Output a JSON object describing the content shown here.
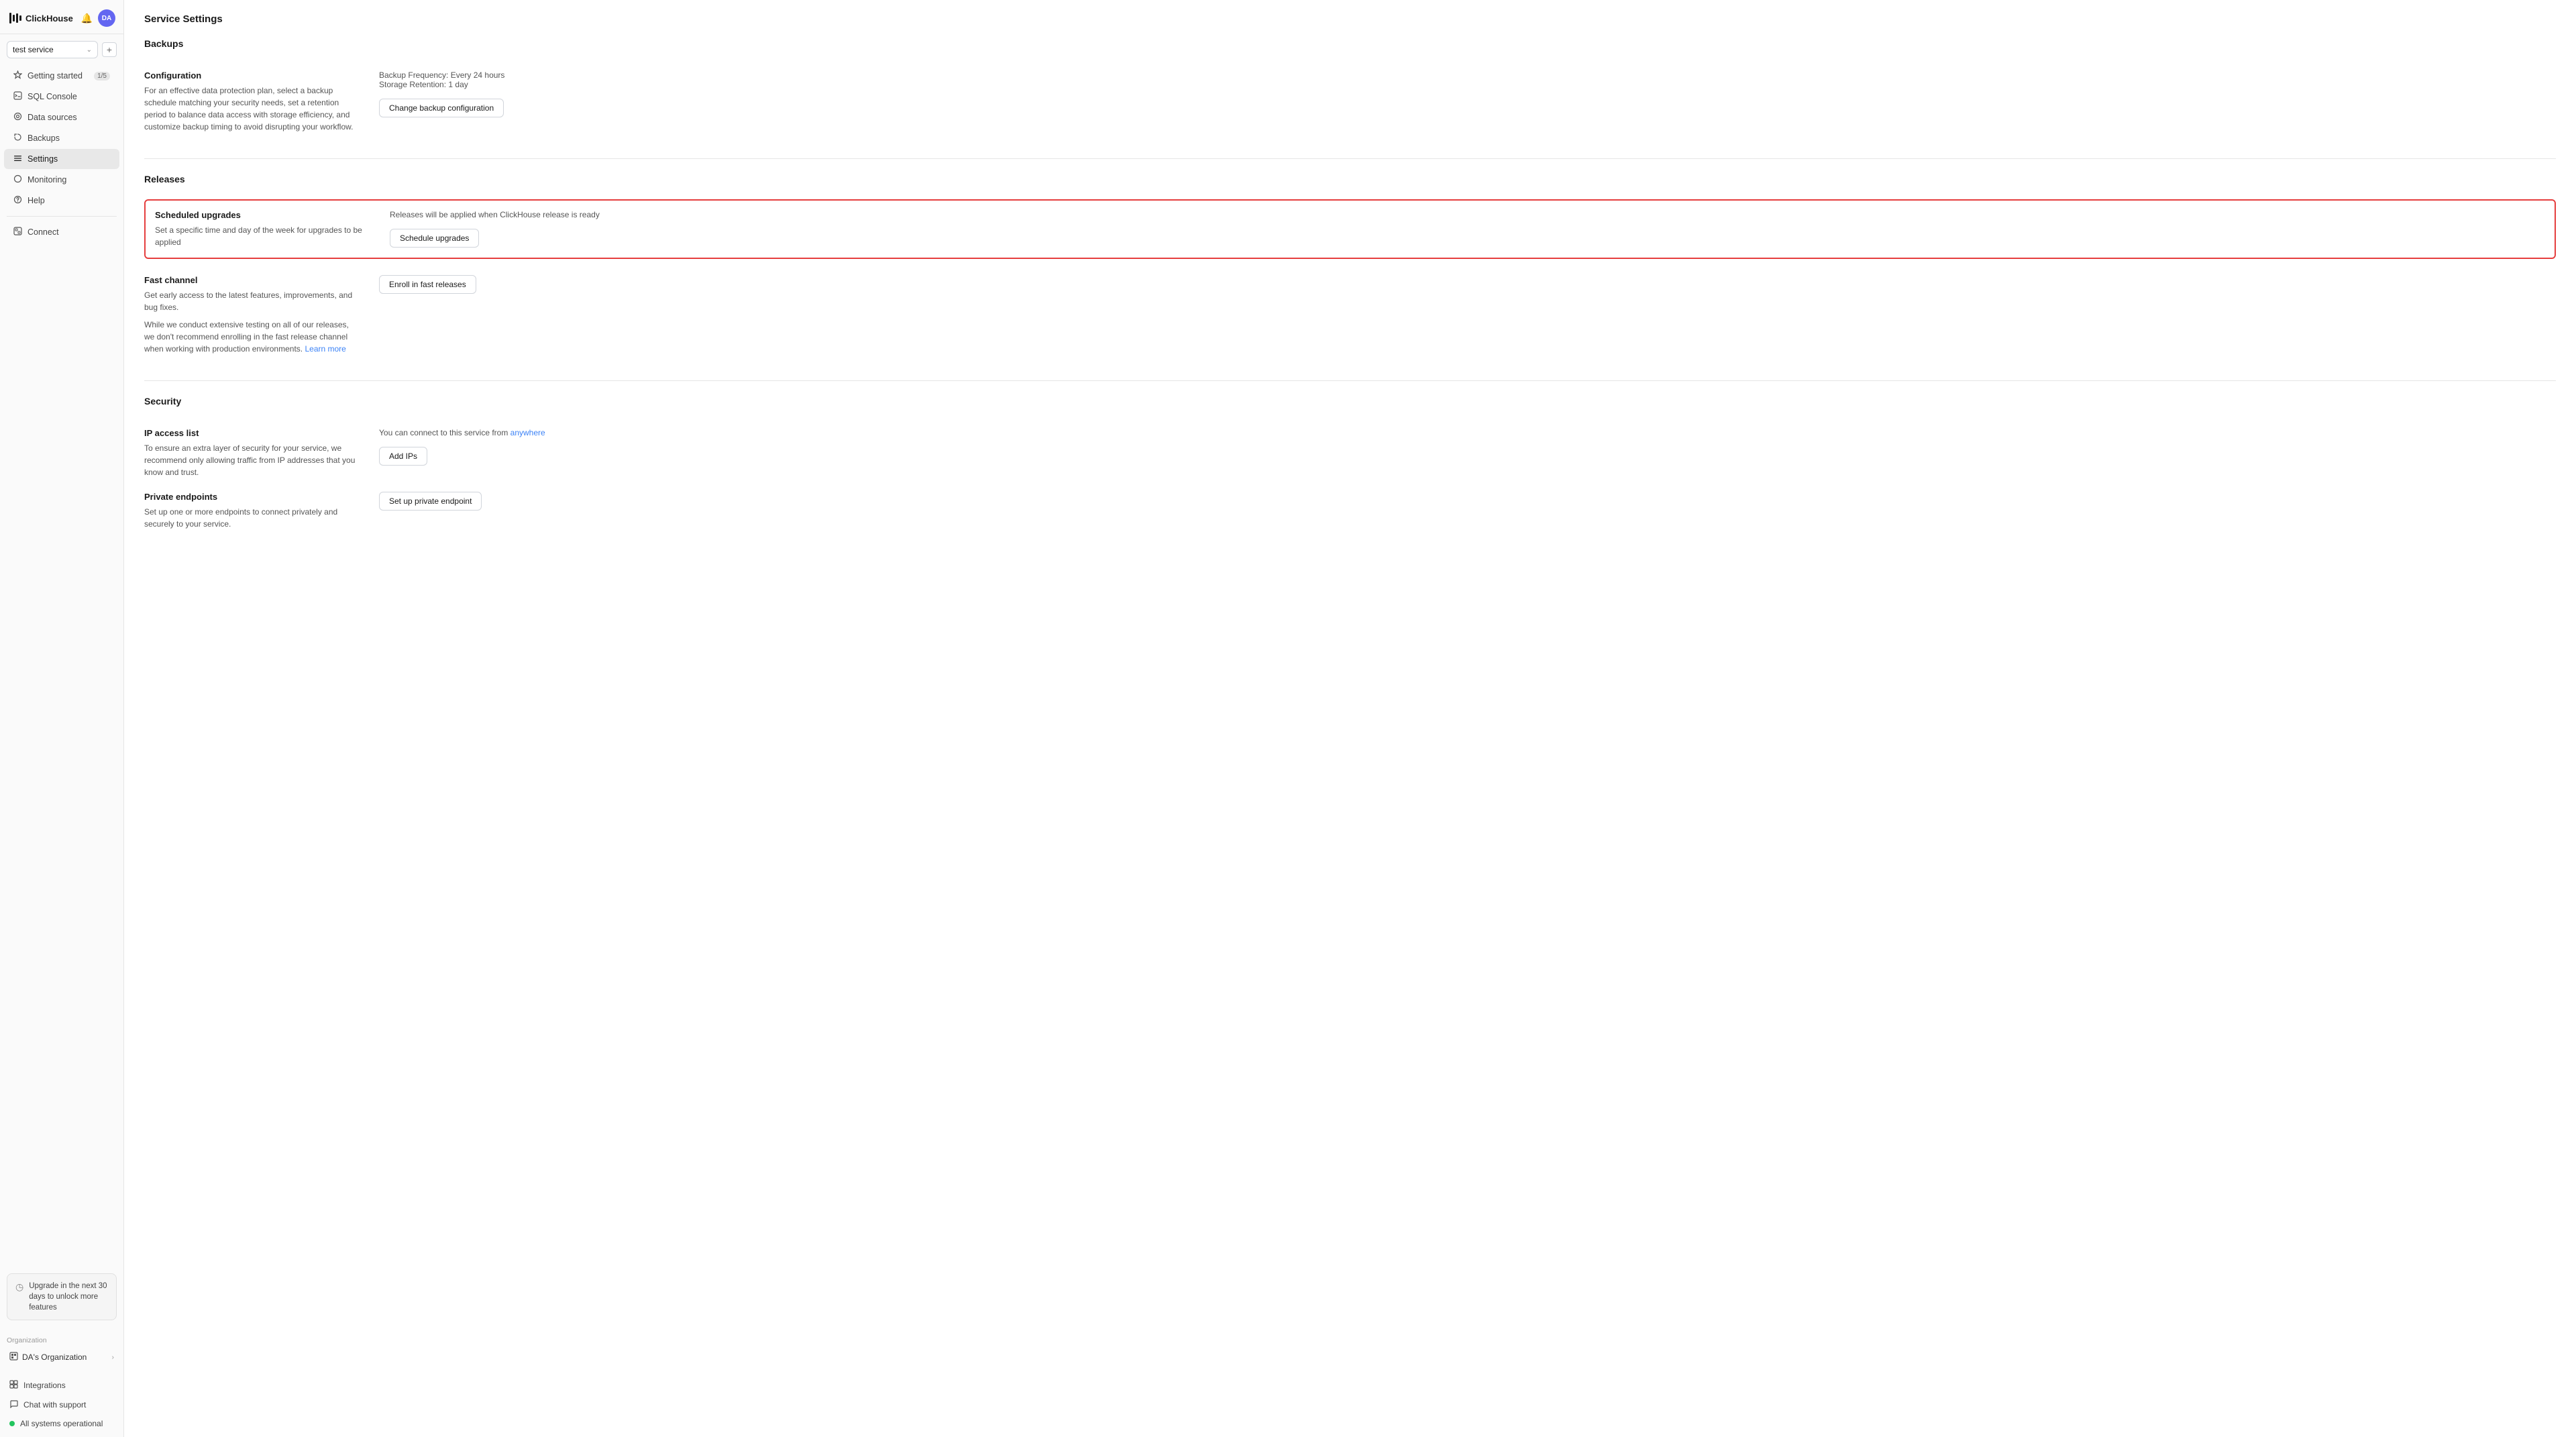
{
  "app": {
    "logo_text": "ClickHouse",
    "page_title": "Service Settings"
  },
  "header": {
    "bell_label": "🔔",
    "avatar_label": "DA"
  },
  "service_selector": {
    "current": "test service",
    "add_label": "+"
  },
  "nav": {
    "items": [
      {
        "id": "getting-started",
        "label": "Getting started",
        "icon": "✦",
        "badge": "1/5"
      },
      {
        "id": "sql-console",
        "label": "SQL Console",
        "icon": "▭",
        "badge": null
      },
      {
        "id": "data-sources",
        "label": "Data sources",
        "icon": "◎",
        "badge": null
      },
      {
        "id": "backups",
        "label": "Backups",
        "icon": "⊙",
        "badge": null
      },
      {
        "id": "settings",
        "label": "Settings",
        "icon": "☰",
        "badge": null,
        "active": true
      },
      {
        "id": "monitoring",
        "label": "Monitoring",
        "icon": "○",
        "badge": null
      },
      {
        "id": "help",
        "label": "Help",
        "icon": "○",
        "badge": null
      }
    ],
    "connect_item": {
      "id": "connect",
      "label": "Connect",
      "icon": "▣"
    }
  },
  "upgrade": {
    "icon": "◷",
    "text": "Upgrade in the next 30 days to unlock more features"
  },
  "organization": {
    "label": "Organization",
    "name": "DA's Organization",
    "icon": "▣",
    "arrow": "›"
  },
  "bottom_links": [
    {
      "id": "integrations",
      "label": "Integrations",
      "icon": "⊞"
    },
    {
      "id": "chat-support",
      "label": "Chat with support",
      "icon": "▭"
    }
  ],
  "status": {
    "dot_color": "#22c55e",
    "text": "All systems operational"
  },
  "settings": {
    "backups": {
      "section_title": "Backups",
      "configuration": {
        "title": "Configuration",
        "desc": "For an effective data protection plan, select a backup schedule matching your security needs, set a retention period to balance data access with storage efficiency, and customize backup timing to avoid disrupting your workflow.",
        "frequency_label": "Backup Frequency: Every 24 hours",
        "retention_label": "Storage Retention: 1 day",
        "button_label": "Change backup configuration"
      }
    },
    "releases": {
      "section_title": "Releases",
      "scheduled_upgrades": {
        "title": "Scheduled upgrades",
        "desc": "Set a specific time and day of the week for upgrades to be applied",
        "status_text": "Releases will be applied when ClickHouse release is ready",
        "button_label": "Schedule upgrades",
        "highlighted": true
      },
      "fast_channel": {
        "title": "Fast channel",
        "desc1": "Get early access to the latest features, improvements, and bug fixes.",
        "desc2": "While we conduct extensive testing on all of our releases, we don't recommend enrolling in the fast release channel when working with production environments.",
        "learn_more_label": "Learn more",
        "button_label": "Enroll in fast releases"
      }
    },
    "security": {
      "section_title": "Security",
      "ip_access": {
        "title": "IP access list",
        "info_prefix": "You can connect to this service from ",
        "info_link": "anywhere",
        "desc": "To ensure an extra layer of security for your service, we recommend only allowing traffic from IP addresses that you know and trust.",
        "button_label": "Add IPs"
      },
      "private_endpoints": {
        "title": "Private endpoints",
        "desc": "Set up one or more endpoints to connect privately and securely to your service.",
        "button_label": "Set up private endpoint"
      }
    }
  }
}
